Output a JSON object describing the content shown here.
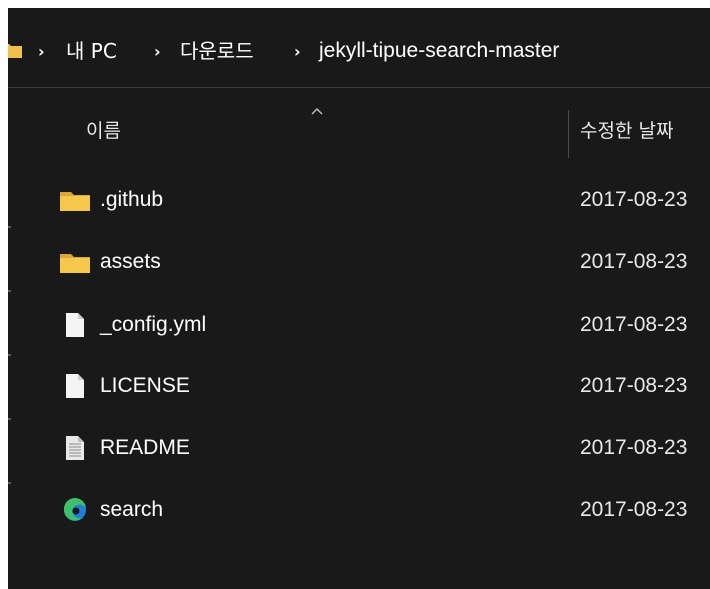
{
  "breadcrumb": {
    "items": [
      "내 PC",
      "다운로드",
      "jekyll-tipue-search-master"
    ],
    "separator": "›"
  },
  "columns": {
    "name": "이름",
    "date_modified": "수정한 날짜"
  },
  "files": [
    {
      "name": ".github",
      "type": "folder",
      "icon": "folder-icon",
      "date": "2017-08-23"
    },
    {
      "name": "assets",
      "type": "folder",
      "icon": "folder-icon",
      "date": "2017-08-23"
    },
    {
      "name": "_config.yml",
      "type": "file",
      "icon": "file-icon",
      "date": "2017-08-23"
    },
    {
      "name": "LICENSE",
      "type": "file",
      "icon": "file-icon",
      "date": "2017-08-23"
    },
    {
      "name": "README",
      "type": "text",
      "icon": "text-file-icon",
      "date": "2017-08-23"
    },
    {
      "name": "search",
      "type": "html",
      "icon": "edge-icon",
      "date": "2017-08-23"
    }
  ],
  "colors": {
    "background": "#191919",
    "text": "#ffffff",
    "folder": "#f0c14b",
    "edge_blue": "#1f7fd6",
    "edge_green": "#3fbf6a"
  }
}
